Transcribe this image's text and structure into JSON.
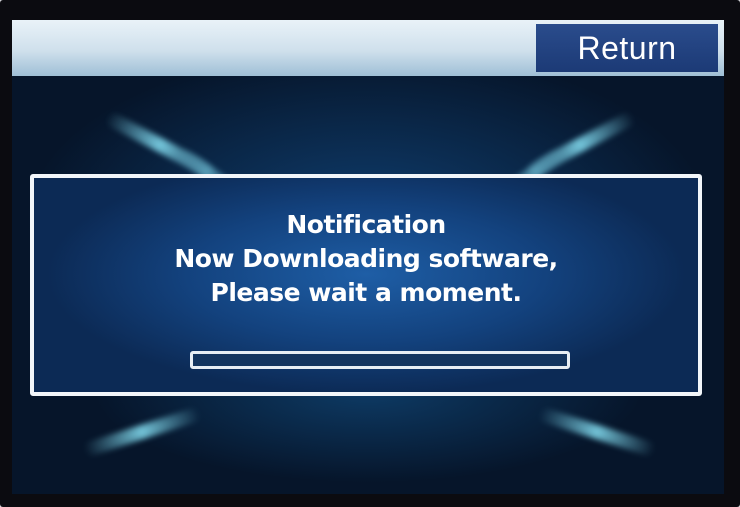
{
  "header": {
    "return_label": "Return"
  },
  "notification": {
    "title": "Notification",
    "line1": "Now Downloading software,",
    "line2": "Please wait a moment.",
    "progress_fraction": 0.0
  },
  "colors": {
    "header_bg": "#cfe0ec",
    "return_bg": "#1c3a76",
    "dialog_bg": "#13427e",
    "accent_glow": "#8cebff",
    "text": "#ffffff"
  }
}
